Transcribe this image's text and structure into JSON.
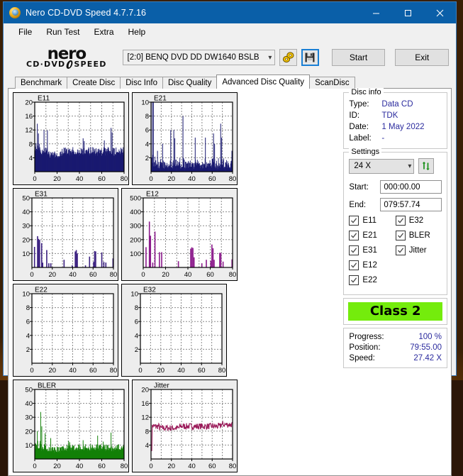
{
  "window": {
    "title": "Nero CD-DVD Speed 4.7.7.16",
    "icon": "nero-app-icon",
    "minimize_label": "Minimize",
    "maximize_label": "Maximize",
    "close_label": "Close"
  },
  "menu": [
    "File",
    "Run Test",
    "Extra",
    "Help"
  ],
  "toolbar": {
    "logo_word": "nero",
    "logo_sub_left": "CD·DVD",
    "logo_sub_right": "SPEED",
    "drive": "[2:0]   BENQ DVD DD DW1640 BSLB",
    "disc_icon": "disc-tool-icon",
    "save_icon": "save-floppy-icon",
    "start_label": "Start",
    "exit_label": "Exit"
  },
  "tabs": [
    {
      "label": "Benchmark",
      "active": false
    },
    {
      "label": "Create Disc",
      "active": false
    },
    {
      "label": "Disc Info",
      "active": false
    },
    {
      "label": "Disc Quality",
      "active": false
    },
    {
      "label": "Advanced Disc Quality",
      "active": true
    },
    {
      "label": "ScanDisc",
      "active": false
    }
  ],
  "disc_info": {
    "title": "Disc info",
    "rows": [
      {
        "key": "Type:",
        "value": "Data CD"
      },
      {
        "key": "ID:",
        "value": "TDK"
      },
      {
        "key": "Date:",
        "value": "1 May 2022"
      },
      {
        "key": "Label:",
        "value": "-"
      }
    ]
  },
  "settings": {
    "title": "Settings",
    "speed": "24 X",
    "refresh_icon": "refresh-arrows-icon",
    "start_label": "Start:",
    "start_value": "000:00.00",
    "end_label": "End:",
    "end_value": "079:57.74",
    "checkboxes": [
      {
        "label": "E11",
        "checked": true
      },
      {
        "label": "E32",
        "checked": true
      },
      {
        "label": "E21",
        "checked": true
      },
      {
        "label": "BLER",
        "checked": true
      },
      {
        "label": "E31",
        "checked": true
      },
      {
        "label": "Jitter",
        "checked": true
      },
      {
        "label": "E12",
        "checked": true
      },
      {
        "label": "",
        "checked": null
      },
      {
        "label": "E22",
        "checked": true
      },
      {
        "label": "",
        "checked": null
      }
    ]
  },
  "quality": {
    "class_label": "Class 2",
    "class_color": "#74ec0c"
  },
  "stats": [
    {
      "key": "Progress:",
      "value": "100 %"
    },
    {
      "key": "Position:",
      "value": "79:55.00"
    },
    {
      "key": "Speed:",
      "value": "27.42 X"
    }
  ],
  "chart_data": [
    {
      "type": "bar",
      "title": "E11",
      "color": "#191970",
      "xlabel": "",
      "ylabel": "",
      "xlim": [
        0,
        80
      ],
      "ylim": [
        0,
        20
      ],
      "xticks": [
        0,
        20,
        40,
        60,
        80
      ],
      "yticks": [
        4,
        8,
        12,
        16,
        20
      ],
      "grid": true,
      "seed": 11,
      "baseline": 4.6,
      "noise": 2.4,
      "spikes": [
        [
          2,
          13.8
        ],
        [
          3,
          11.0
        ],
        [
          8,
          12.0
        ],
        [
          11,
          11.9
        ],
        [
          43,
          9.6
        ],
        [
          44,
          8.8
        ],
        [
          62,
          9.0
        ],
        [
          68,
          12.6
        ],
        [
          69,
          11.3
        ]
      ],
      "points": 300
    },
    {
      "type": "bar",
      "title": "E21",
      "color": "#191970",
      "xlabel": "",
      "ylabel": "",
      "xlim": [
        0,
        80
      ],
      "ylim": [
        0,
        10
      ],
      "xticks": [
        0,
        20,
        40,
        60,
        80
      ],
      "yticks": [
        2,
        4,
        6,
        8,
        10
      ],
      "grid": true,
      "seed": 21,
      "baseline": 0.4,
      "noise": 1.5,
      "spikes": [
        [
          1,
          10.0
        ],
        [
          2,
          10.0
        ],
        [
          6,
          3.0
        ],
        [
          11,
          4.0
        ],
        [
          19,
          6.0
        ],
        [
          22,
          6.0
        ],
        [
          23,
          4.8
        ],
        [
          31,
          8.0
        ],
        [
          43,
          4.9
        ],
        [
          53,
          4.9
        ],
        [
          61,
          5.5
        ],
        [
          62,
          4.0
        ],
        [
          68,
          6.9
        ],
        [
          69,
          4.9
        ],
        [
          79,
          3.0
        ]
      ],
      "points": 220
    },
    {
      "type": "bar",
      "title": "E31",
      "color": "#3b2080",
      "xlabel": "",
      "ylabel": "",
      "xlim": [
        0,
        80
      ],
      "ylim": [
        0,
        50
      ],
      "xticks": [
        0,
        20,
        40,
        60,
        80
      ],
      "yticks": [
        10,
        20,
        30,
        40,
        50
      ],
      "grid": true,
      "seed": 31,
      "baseline": 0,
      "noise": 0,
      "spikes": [
        [
          2,
          14.8
        ],
        [
          5,
          22.5
        ],
        [
          6,
          20.5
        ],
        [
          7,
          19.8
        ],
        [
          9,
          17.5
        ],
        [
          10,
          3.5
        ],
        [
          14,
          12.5
        ],
        [
          16,
          3.0
        ],
        [
          18,
          3.0
        ],
        [
          31,
          5.5
        ],
        [
          39,
          1.5
        ],
        [
          42,
          11.5
        ],
        [
          43,
          12.5
        ],
        [
          44,
          10.0
        ],
        [
          52,
          1.5
        ],
        [
          56,
          7.8
        ],
        [
          60,
          4.0
        ],
        [
          61,
          11.8
        ],
        [
          62,
          11.5
        ],
        [
          68,
          10.8
        ],
        [
          70,
          4.0
        ],
        [
          72,
          3.5
        ],
        [
          79,
          6.5
        ]
      ],
      "points": 80
    },
    {
      "type": "bar",
      "title": "E12",
      "color": "#8b1a8b",
      "xlabel": "",
      "ylabel": "",
      "xlim": [
        0,
        80
      ],
      "ylim": [
        0,
        500
      ],
      "xticks": [
        0,
        20,
        40,
        60,
        80
      ],
      "yticks": [
        100,
        200,
        300,
        400,
        500
      ],
      "grid": true,
      "seed": 12,
      "baseline": 0,
      "noise": 0,
      "spikes": [
        [
          2,
          146
        ],
        [
          5,
          330
        ],
        [
          6,
          228
        ],
        [
          8,
          35
        ],
        [
          10,
          258
        ],
        [
          14,
          110
        ],
        [
          16,
          110
        ],
        [
          31,
          45
        ],
        [
          42,
          135
        ],
        [
          43,
          145
        ],
        [
          44,
          140
        ],
        [
          45,
          73
        ],
        [
          52,
          30
        ],
        [
          56,
          55
        ],
        [
          60,
          48
        ],
        [
          61,
          165
        ],
        [
          62,
          138
        ],
        [
          63,
          55
        ],
        [
          68,
          105
        ],
        [
          69,
          105
        ],
        [
          71,
          42
        ],
        [
          79,
          58
        ]
      ],
      "points": 80
    },
    {
      "type": "bar",
      "title": "E22",
      "color": "#8b1a8b",
      "xlabel": "",
      "ylabel": "",
      "xlim": [
        0,
        80
      ],
      "ylim": [
        0,
        10
      ],
      "xticks": [
        0,
        20,
        40,
        60,
        80
      ],
      "yticks": [
        2,
        4,
        6,
        8,
        10
      ],
      "grid": true,
      "seed": 22,
      "baseline": 0,
      "noise": 0,
      "spikes": [],
      "points": 0
    },
    {
      "type": "bar",
      "title": "E32",
      "color": "#3b2080",
      "xlabel": "",
      "ylabel": "",
      "xlim": [
        0,
        80
      ],
      "ylim": [
        0,
        10
      ],
      "xticks": [
        0,
        20,
        40,
        60,
        80
      ],
      "yticks": [
        2,
        4,
        6,
        8,
        10
      ],
      "grid": true,
      "seed": 32,
      "baseline": 0,
      "noise": 0,
      "spikes": [],
      "points": 0
    },
    {
      "type": "bar",
      "title": "BLER",
      "color": "#138008",
      "xlabel": "",
      "ylabel": "",
      "xlim": [
        0,
        80
      ],
      "ylim": [
        0,
        50
      ],
      "xticks": [
        0,
        20,
        40,
        60,
        80
      ],
      "yticks": [
        10,
        20,
        30,
        40,
        50
      ],
      "grid": true,
      "seed": 99,
      "baseline": 5.5,
      "noise": 5.0,
      "spikes": [
        [
          2,
          20.0
        ],
        [
          5,
          33.8
        ],
        [
          6,
          23.5
        ],
        [
          9,
          18.5
        ],
        [
          14,
          15.0
        ],
        [
          30,
          13.0
        ],
        [
          31,
          12.0
        ],
        [
          43,
          13.5
        ],
        [
          56,
          16.8
        ],
        [
          61,
          12.5
        ],
        [
          68,
          19.0
        ]
      ],
      "points": 300
    },
    {
      "type": "line",
      "title": "Jitter",
      "color": "#9b1b5a",
      "xlabel": "",
      "ylabel": "",
      "xlim": [
        0,
        80
      ],
      "ylim": [
        0,
        20
      ],
      "xticks": [
        0,
        20,
        40,
        60,
        80
      ],
      "yticks": [
        4,
        8,
        12,
        16,
        20
      ],
      "grid": true,
      "seed": 7,
      "baseline": 9.4,
      "noise": 0.9,
      "start_dip": 2.4,
      "points": 200
    }
  ]
}
